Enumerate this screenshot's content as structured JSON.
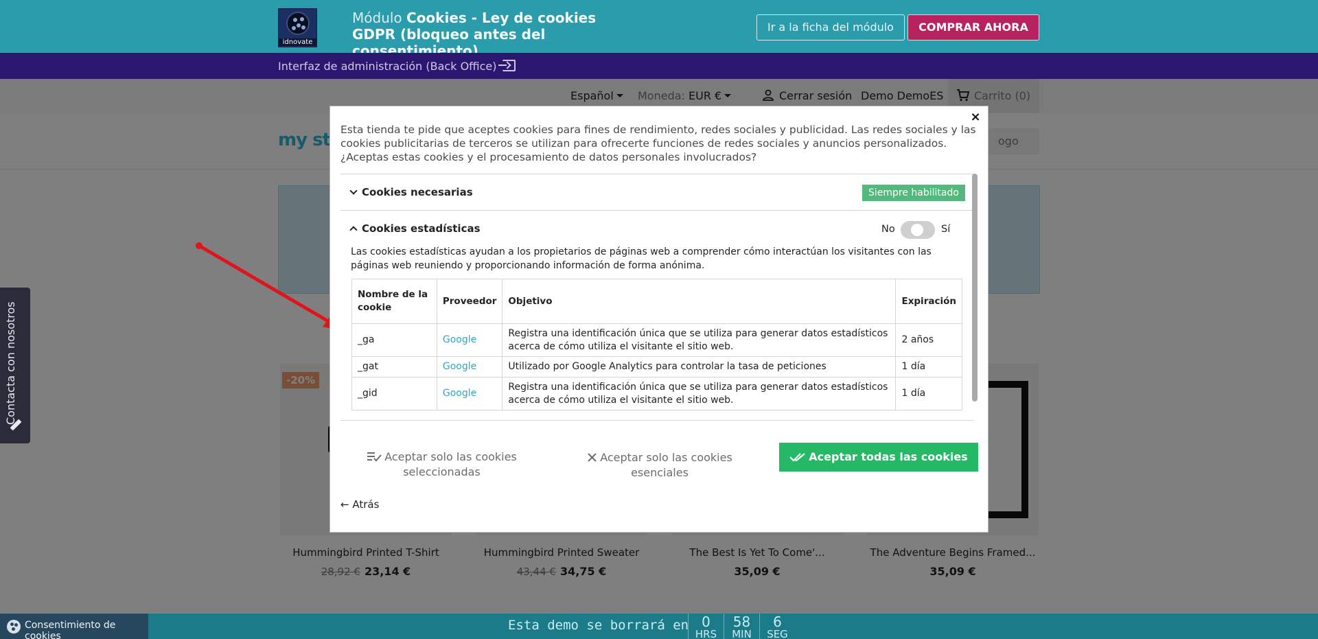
{
  "promo": {
    "logo_text": "idnovate",
    "title_prefix": "Módulo ",
    "title_bold": "Cookies - Ley de cookies GDPR (bloqueo antes del consentimiento)",
    "btn_ficha": "Ir a la ficha del módulo",
    "btn_comprar": "COMPRAR AHORA"
  },
  "admin": {
    "link": "Interfaz de administración (Back Office)",
    "icon": "logout-icon"
  },
  "shop_nav": {
    "language": "Español",
    "currency_label": "Moneda:",
    "currency_value": "EUR €",
    "logout": "Cerrar sesión",
    "user": "Demo DemoES",
    "cart": "Carrito (0)"
  },
  "shop": {
    "logo": "my sto",
    "search_placeholder": "ogo"
  },
  "products": [
    {
      "name": "Hummingbird Printed T-Shirt",
      "old_price": "28,92 €",
      "price": "23,14 €",
      "discount": "-20%"
    },
    {
      "name": "Hummingbird Printed Sweater",
      "old_price": "43,44 €",
      "price": "34,75 €"
    },
    {
      "name": "The Best Is Yet To Come'...",
      "price": "35,09 €"
    },
    {
      "name": "The Adventure Begins Framed...",
      "price": "35,09 €"
    }
  ],
  "contact_tab": "Contacta con nosotros",
  "modal": {
    "close": "×",
    "intro": "Esta tienda te pide que aceptes cookies para fines de rendimiento, redes sociales y publicidad. Las redes sociales y las cookies publicitarias de terceros se utilizan para ofrecerte funciones de redes sociales y anuncios personalizados. ¿Aceptas estas cookies y el procesamiento de datos personales involucrados?",
    "necessary": {
      "title": "Cookies necesarias",
      "badge": "Siempre habilitado"
    },
    "statistics": {
      "title": "Cookies estadísticas",
      "toggle_no": "No",
      "toggle_yes": "Sí",
      "description": "Las cookies estadísticas ayudan a los propietarios de páginas web a comprender cómo interactúan los visitantes con las páginas web reuniendo y proporcionando información de forma anónima.",
      "headers": [
        "Nombre de la cookie",
        "Proveedor",
        "Objetivo",
        "Expiración"
      ],
      "rows": [
        [
          "_ga",
          "Google",
          "Registra una identificación única que se utiliza para generar datos estadísticos acerca de cómo utiliza el visitante el sitio web.",
          "2 años"
        ],
        [
          "_gat",
          "Google",
          "Utilizado por Google Analytics para controlar la tasa de peticiones",
          "1 día"
        ],
        [
          "_gid",
          "Google",
          "Registra una identificación única que se utiliza para generar datos estadísticos acerca de cómo utiliza el visitante el sitio web.",
          "1 día"
        ]
      ]
    },
    "btn_selected": "Aceptar solo las cookies seleccionadas",
    "btn_essential": "Aceptar solo las cookies esenciales",
    "btn_all": "Aceptar todas las cookies",
    "back": "← Atrás"
  },
  "bottom": {
    "consent_tab": "Consentimiento de cookies",
    "countdown_text": "Esta demo se borrará en",
    "hours": "0",
    "hours_unit": "HRS",
    "minutes": "58",
    "minutes_unit": "MIN",
    "seconds": "6",
    "seconds_unit": "SEG"
  },
  "colors": {
    "promo_bg": "#2a9cac",
    "admin_bg": "#2b1770",
    "buy_button": "#b8225f",
    "accept_all": "#26b965",
    "badge_green": "#53b87b",
    "link_blue": "#2ea7c4",
    "arrow": "#e0141b"
  }
}
